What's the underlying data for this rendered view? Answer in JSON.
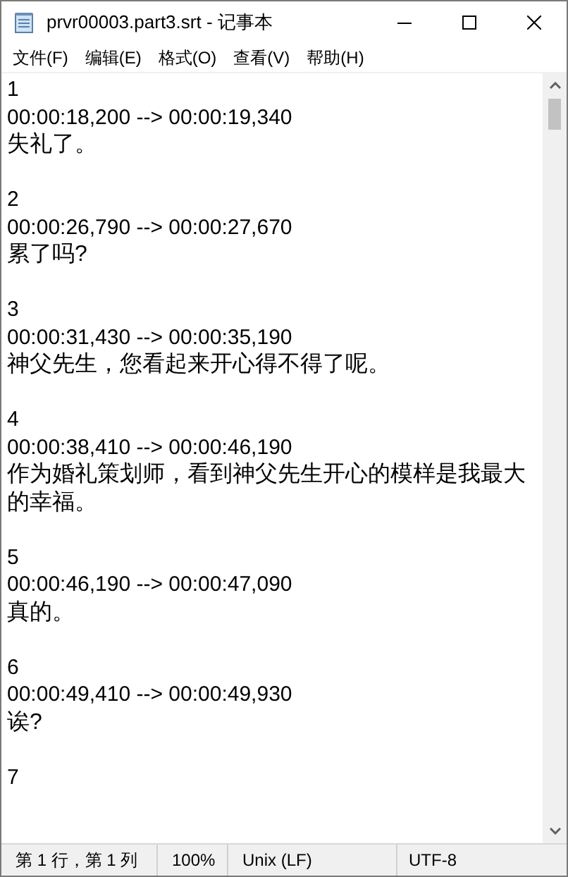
{
  "window": {
    "title": "prvr00003.part3.srt - 记事本"
  },
  "menu": [
    "文件(F)",
    "编辑(E)",
    "格式(O)",
    "查看(V)",
    "帮助(H)"
  ],
  "entries": [
    {
      "index": "1",
      "time": "00:00:18,200 --> 00:00:19,340",
      "text": "失礼了。"
    },
    {
      "index": "2",
      "time": "00:00:26,790 --> 00:00:27,670",
      "text": "累了吗?"
    },
    {
      "index": "3",
      "time": "00:00:31,430 --> 00:00:35,190",
      "text": "神父先生，您看起来开心得不得了呢。"
    },
    {
      "index": "4",
      "time": "00:00:38,410 --> 00:00:46,190",
      "text": "作为婚礼策划师，看到神父先生开心的模样是我最大的幸福。"
    },
    {
      "index": "5",
      "time": "00:00:46,190 --> 00:00:47,090",
      "text": "真的。"
    },
    {
      "index": "6",
      "time": "00:00:49,410 --> 00:00:49,930",
      "text": "诶?"
    },
    {
      "index": "7"
    }
  ],
  "status_bar": [
    "第 1 行，第 1 列",
    "100%",
    "Unix (LF)",
    "UTF-8"
  ]
}
